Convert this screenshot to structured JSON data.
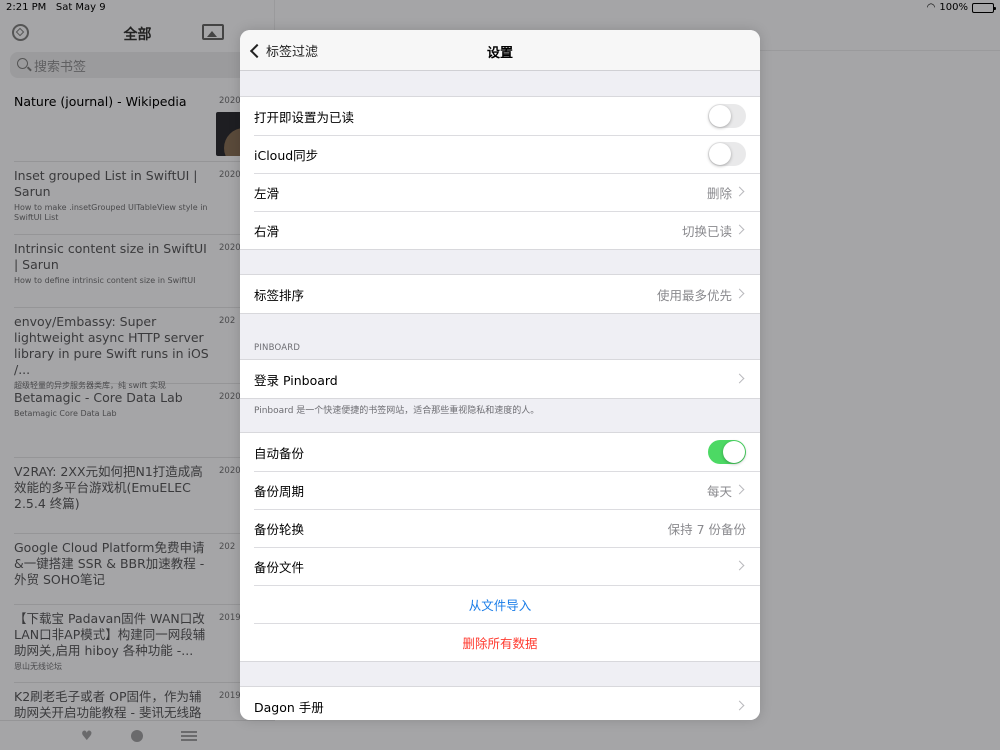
{
  "status_bar": {
    "time": "2:21 PM",
    "date": "Sat May 9",
    "battery": "100%",
    "battery_level": 1.0
  },
  "sidebar": {
    "title": "全部",
    "search_placeholder": "搜索书签",
    "items": [
      {
        "title": "Nature (journal) - Wikipedia",
        "desc": "",
        "date": "2020"
      },
      {
        "title": "Inset grouped List in SwiftUI | Sarun",
        "desc": "How to make .insetGrouped UITableView style in SwiftUI List",
        "date": "2020"
      },
      {
        "title": "Intrinsic content size in SwiftUI | Sarun",
        "desc": "How to define intrinsic content size in SwiftUI",
        "date": "2020"
      },
      {
        "title": "envoy/Embassy: Super lightweight async HTTP server library in pure Swift runs in iOS /...",
        "desc": "超级轻量的异步服务器类库，纯 swift 实现",
        "date": "202"
      },
      {
        "title": "Betamagic - Core Data Lab",
        "desc": "Betamagic Core Data Lab",
        "date": "2020"
      },
      {
        "title": "V2RAY: 2XX元如何把N1打造成高效能的多平台游戏机(EmuELEC 2.5.4 终篇)",
        "desc": "",
        "date": "2020"
      },
      {
        "title": "Google Cloud Platform免费申请&一键搭建 SSR & BBR加速教程 - 外贸 SOHO笔记",
        "desc": "",
        "date": "202"
      },
      {
        "title": "【下载宝 Padavan固件 WAN口改LAN口非AP模式】构建同一网段辅助网关,启用 hiboy 各种功能 -...",
        "desc": "恩山无线论坛",
        "date": "2019/"
      },
      {
        "title": "K2刷老毛子或者 OP固件，作为辅助网关开启功能教程 - 斐讯无线路",
        "desc": "",
        "date": "2019/"
      }
    ]
  },
  "settings": {
    "back_label": "标签过滤",
    "title": "设置",
    "group1": [
      {
        "label": "打开即设置为已读",
        "toggle": false
      },
      {
        "label": "iCloud同步",
        "toggle": false
      },
      {
        "label": "左滑",
        "value": "删除"
      },
      {
        "label": "右滑",
        "value": "切换已读"
      }
    ],
    "group2": [
      {
        "label": "标签排序",
        "value": "使用最多优先"
      }
    ],
    "pinboard_header": "PINBOARD",
    "pinboard_login": "登录 Pinboard",
    "pinboard_footer": "Pinboard 是一个快速便捷的书签网站，适合那些重视隐私和速度的人。",
    "backup": {
      "auto_backup": "自动备份",
      "auto_backup_on": true,
      "period_label": "备份周期",
      "period_value": "每天",
      "rotation_label": "备份轮换",
      "rotation_value": "保持 7 份备份",
      "files_label": "备份文件",
      "import_label": "从文件导入",
      "delete_label": "删除所有数据"
    },
    "manual_label": "Dagon 手册"
  },
  "colors": {
    "accent": "#1a7de8",
    "destructive": "#ff3b30",
    "toggle_on": "#4cd964"
  }
}
